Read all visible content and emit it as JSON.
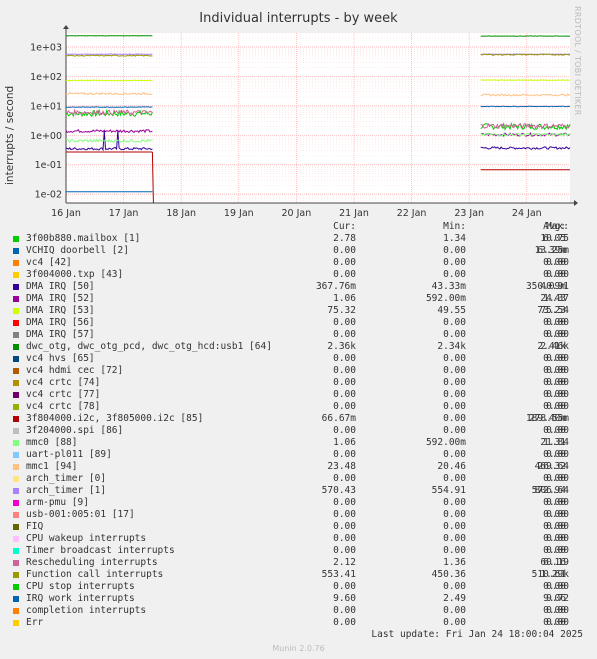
{
  "title": "Individual interrupts - by week",
  "side_label": "RRDTOOL / TOBI OETIKER",
  "footer": "Last update: Fri Jan 24 18:00:04 2025",
  "munin": "Munin 2.0.76",
  "headers": [
    "Cur:",
    "Min:",
    "Avg:",
    "Max:"
  ],
  "chart_data": {
    "type": "line",
    "title": "Individual interrupts - by week",
    "ylabel": "interrupts / second",
    "yscale": "log",
    "ylim": [
      0.005,
      3000
    ],
    "y_ticks": [
      "1e-02",
      "1e-01",
      "1e+00",
      "1e+01",
      "1e+02",
      "1e+03"
    ],
    "y_tick_values": [
      0.01,
      0.1,
      1,
      10,
      100,
      1000
    ],
    "x_ticks": [
      "16 Jan",
      "17 Jan",
      "18 Jan",
      "19 Jan",
      "20 Jan",
      "21 Jan",
      "22 Jan",
      "23 Jan",
      "24 Jan"
    ],
    "x_range_days": [
      16,
      24.75
    ],
    "segments": [
      [
        16,
        17.5
      ],
      [
        23.2,
        24.75
      ]
    ],
    "grid": true,
    "series": [
      {
        "name": "3f00b880.mailbox [1]",
        "color": "#00cc00",
        "cur": "2.78",
        "min": "1.34",
        "avg": "6.05",
        "max": "10.75",
        "v1": 5.5,
        "v2": 2.0,
        "noise": 0.1
      },
      {
        "name": "VCHIQ doorbell [2]",
        "color": "#0066b3",
        "cur": "0.00",
        "min": "0.00",
        "avg": "6.39m",
        "max": "13.25m",
        "v1": 0.012,
        "v2": null,
        "noise": 0
      },
      {
        "name": "vc4 [42]",
        "color": "#ff8000",
        "cur": "0.00",
        "min": "0.00",
        "avg": "0.00",
        "max": "0.00",
        "v1": null,
        "v2": null,
        "noise": 0
      },
      {
        "name": "3f004000.txp [43]",
        "color": "#ffcc00",
        "cur": "0.00",
        "min": "0.00",
        "avg": "0.00",
        "max": "0.00",
        "v1": null,
        "v2": null,
        "noise": 0
      },
      {
        "name": "DMA IRQ [50]",
        "color": "#330099",
        "cur": "367.76m",
        "min": "43.33m",
        "avg": "350.09m",
        "max": "40.91",
        "v1": 0.35,
        "v2": 0.37,
        "noise": 0.04,
        "spikes": true
      },
      {
        "name": "DMA IRQ [52]",
        "color": "#990099",
        "cur": "1.06",
        "min": "592.00m",
        "avg": "1.43",
        "max": "24.37",
        "v1": 1.4,
        "v2": 1.06,
        "noise": 0.05
      },
      {
        "name": "DMA IRQ [53]",
        "color": "#ccff00",
        "cur": "75.32",
        "min": "49.55",
        "avg": "73.23",
        "max": "75.54",
        "v1": 73,
        "v2": 75,
        "noise": 0.01
      },
      {
        "name": "DMA IRQ [56]",
        "color": "#ff0000",
        "cur": "0.00",
        "min": "0.00",
        "avg": "0.00",
        "max": "0.00",
        "v1": null,
        "v2": null,
        "noise": 0
      },
      {
        "name": "DMA IRQ [57]",
        "color": "#808080",
        "cur": "0.00",
        "min": "0.00",
        "avg": "0.00",
        "max": "0.00",
        "v1": null,
        "v2": null,
        "noise": 0
      },
      {
        "name": "dwc_otg, dwc_otg_pcd, dwc_otg_hcd:usb1 [64]",
        "color": "#008f00",
        "cur": "2.36k",
        "min": "2.34k",
        "avg": "2.41k",
        "max": "2.46k",
        "v1": 2410,
        "v2": 2360,
        "noise": 0.005
      },
      {
        "name": "vc4 hvs [65]",
        "color": "#00487d",
        "cur": "0.00",
        "min": "0.00",
        "avg": "0.00",
        "max": "0.00",
        "v1": null,
        "v2": null,
        "noise": 0
      },
      {
        "name": "vc4 hdmi cec [72]",
        "color": "#b35a00",
        "cur": "0.00",
        "min": "0.00",
        "avg": "0.00",
        "max": "0.00",
        "v1": null,
        "v2": null,
        "noise": 0
      },
      {
        "name": "vc4 crtc [74]",
        "color": "#b38f00",
        "cur": "0.00",
        "min": "0.00",
        "avg": "0.00",
        "max": "0.00",
        "v1": null,
        "v2": null,
        "noise": 0
      },
      {
        "name": "vc4 crtc [77]",
        "color": "#6b006b",
        "cur": "0.00",
        "min": "0.00",
        "avg": "0.00",
        "max": "0.00",
        "v1": null,
        "v2": null,
        "noise": 0
      },
      {
        "name": "vc4 crtc [78]",
        "color": "#8fb300",
        "cur": "0.00",
        "min": "0.00",
        "avg": "0.00",
        "max": "0.00",
        "v1": null,
        "v2": null,
        "noise": 0
      },
      {
        "name": "3f804000.i2c, 3f805000.i2c [85]",
        "color": "#b30000",
        "cur": "66.67m",
        "min": "0.00",
        "avg": "189.40m",
        "max": "278.55m",
        "v1": 0.27,
        "v2": 0.067,
        "noise": 0
      },
      {
        "name": "3f204000.spi [86]",
        "color": "#bebebe",
        "cur": "0.00",
        "min": "0.00",
        "avg": "0.00",
        "max": "0.00",
        "v1": null,
        "v2": null,
        "noise": 0
      },
      {
        "name": "mmc0 [88]",
        "color": "#80ff80",
        "cur": "1.06",
        "min": "592.00m",
        "avg": "1.31",
        "max": "21.84",
        "v1": 0.65,
        "v2": 1.06,
        "noise": 0.05
      },
      {
        "name": "uart-pl011 [89]",
        "color": "#80c9ff",
        "cur": "0.00",
        "min": "0.00",
        "avg": "0.00",
        "max": "0.00",
        "v1": null,
        "v2": null,
        "noise": 0
      },
      {
        "name": "mmc1 [94]",
        "color": "#ffc080",
        "cur": "23.48",
        "min": "20.46",
        "avg": "26.32",
        "max": "469.64",
        "v1": 26,
        "v2": 23.5,
        "noise": 0.03
      },
      {
        "name": "arch_timer [0]",
        "color": "#ffe680",
        "cur": "0.00",
        "min": "0.00",
        "avg": "0.00",
        "max": "0.00",
        "v1": null,
        "v2": null,
        "noise": 0
      },
      {
        "name": "arch_timer [1]",
        "color": "#aa80ff",
        "cur": "570.43",
        "min": "554.91",
        "avg": "572.94",
        "max": "806.64",
        "v1": 572,
        "v2": 570,
        "noise": 0.01
      },
      {
        "name": "arm-pmu [9]",
        "color": "#ee00cc",
        "cur": "0.00",
        "min": "0.00",
        "avg": "0.00",
        "max": "0.00",
        "v1": null,
        "v2": null,
        "noise": 0
      },
      {
        "name": "usb-001:005:01 [17]",
        "color": "#ff8080",
        "cur": "0.00",
        "min": "0.00",
        "avg": "0.00",
        "max": "0.00",
        "v1": null,
        "v2": null,
        "noise": 0
      },
      {
        "name": "FIQ",
        "color": "#666600",
        "cur": "0.00",
        "min": "0.00",
        "avg": "0.00",
        "max": "0.00",
        "v1": null,
        "v2": null,
        "noise": 0
      },
      {
        "name": "CPU wakeup interrupts",
        "color": "#ffbfff",
        "cur": "0.00",
        "min": "0.00",
        "avg": "0.00",
        "max": "0.00",
        "v1": null,
        "v2": null,
        "noise": 0
      },
      {
        "name": "Timer broadcast interrupts",
        "color": "#00ffcc",
        "cur": "0.00",
        "min": "0.00",
        "avg": "0.00",
        "max": "0.00",
        "v1": null,
        "v2": null,
        "noise": 0
      },
      {
        "name": "Rescheduling interrupts",
        "color": "#cc6699",
        "cur": "2.12",
        "min": "1.36",
        "avg": "6.16",
        "max": "60.19",
        "v1": 6,
        "v2": 2.1,
        "noise": 0.08
      },
      {
        "name": "Function call interrupts",
        "color": "#999900",
        "cur": "553.41",
        "min": "450.36",
        "avg": "510.61",
        "max": "1.29k",
        "v1": 510,
        "v2": 553,
        "noise": 0.02
      },
      {
        "name": "CPU stop interrupts",
        "color": "#00cc00",
        "cur": "0.00",
        "min": "0.00",
        "avg": "0.00",
        "max": "0.00",
        "v1": null,
        "v2": null,
        "noise": 0
      },
      {
        "name": "IRQ work interrupts",
        "color": "#0066b3",
        "cur": "9.60",
        "min": "2.49",
        "avg": "9.06",
        "max": "9.72",
        "v1": 9.1,
        "v2": 9.6,
        "noise": 0.01
      },
      {
        "name": "completion interrupts",
        "color": "#ff8000",
        "cur": "0.00",
        "min": "0.00",
        "avg": "0.00",
        "max": "0.00",
        "v1": null,
        "v2": null,
        "noise": 0
      },
      {
        "name": "Err",
        "color": "#ffcc00",
        "cur": "0.00",
        "min": "0.00",
        "avg": "0.00",
        "max": "0.00",
        "v1": null,
        "v2": null,
        "noise": 0
      }
    ]
  }
}
